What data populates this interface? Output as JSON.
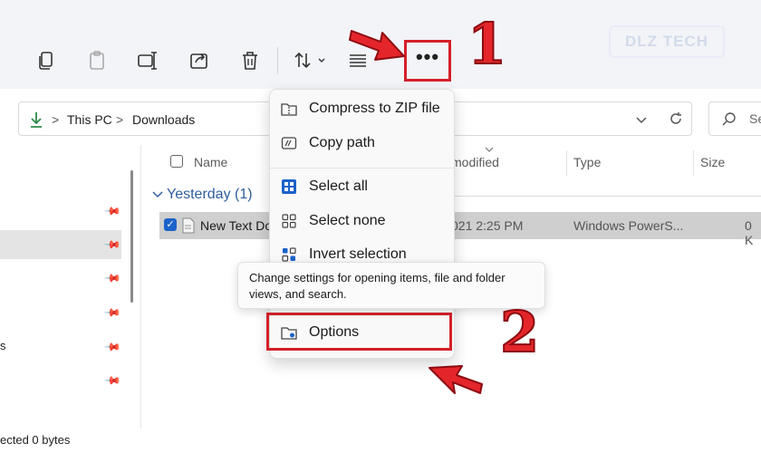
{
  "toolbar": {
    "more_label": "•••",
    "icons": [
      "copy-icon",
      "paste-icon",
      "rename-icon",
      "share-icon",
      "delete-icon",
      "sort-icon",
      "view-icon",
      "more-icon"
    ]
  },
  "watermark": {
    "text": "DLZ TECH"
  },
  "address": {
    "crumbs": [
      "This PC",
      "Downloads"
    ],
    "separator": ">",
    "search_placeholder": "Se"
  },
  "columns": {
    "name": "Name",
    "modified": "modified",
    "type": "Type",
    "size": "Size"
  },
  "group": {
    "label": "Yesterday (1)"
  },
  "file": {
    "name": "New Text Do",
    "modified": "021 2:25 PM",
    "type": "Windows PowerS...",
    "size": "0 K"
  },
  "nav": {
    "partial_label": "s"
  },
  "status": {
    "text": "ected  0 bytes"
  },
  "menu": {
    "items": [
      {
        "label": "Compress to ZIP file"
      },
      {
        "label": "Copy path"
      },
      {
        "label": "Select all"
      },
      {
        "label": "Select none"
      },
      {
        "label": "Invert selection"
      },
      {
        "label": "Options"
      }
    ]
  },
  "tooltip": {
    "text": "Change settings for opening items, file and folder views, and search."
  },
  "annotations": {
    "step1": "1",
    "step2": "2"
  },
  "colors": {
    "annotation_red": "#d4202a",
    "accent_blue": "#1b62c9",
    "download_green": "#2a8a4a"
  }
}
